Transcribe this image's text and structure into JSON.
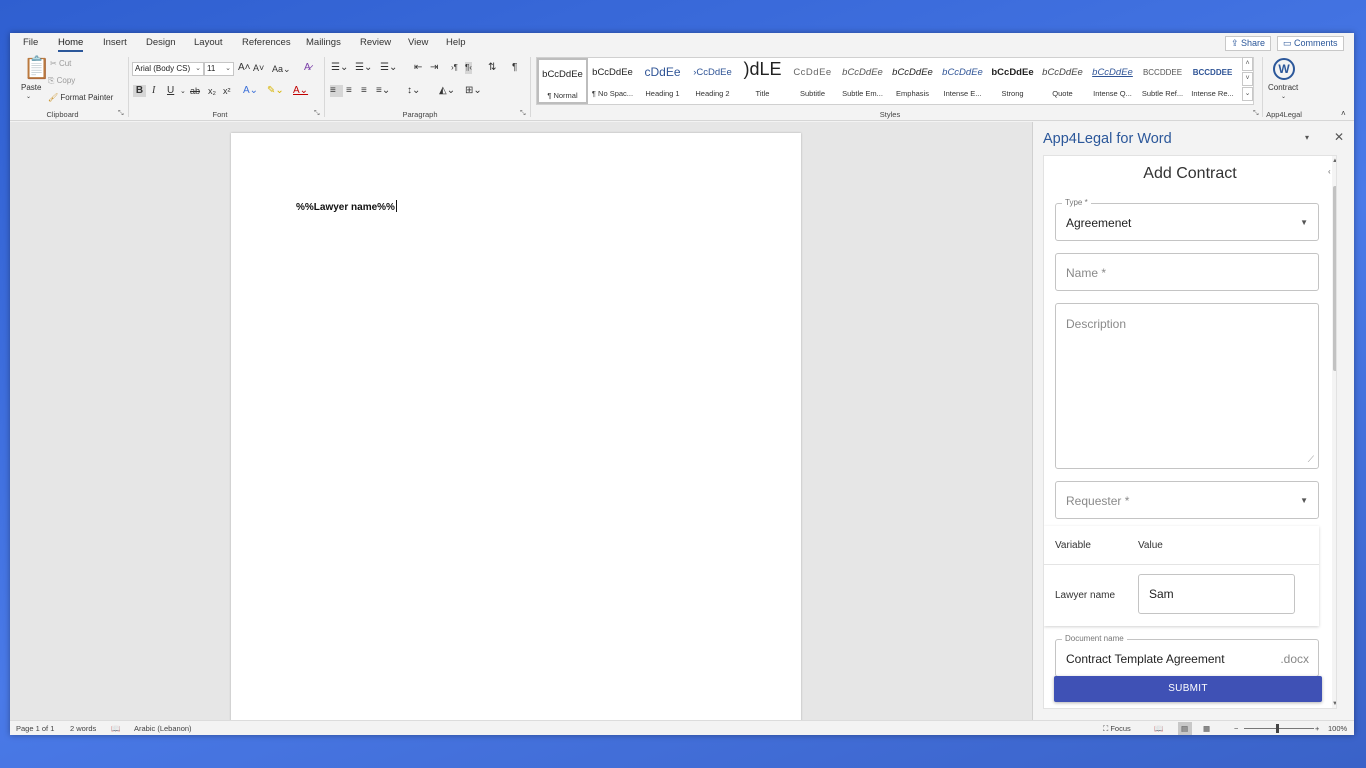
{
  "menu": {
    "tabs": [
      "File",
      "Home",
      "Insert",
      "Design",
      "Layout",
      "References",
      "Mailings",
      "Review",
      "View",
      "Help"
    ],
    "active_tab": "Home",
    "share": "Share",
    "comments": "Comments"
  },
  "ribbon": {
    "clipboard": {
      "paste": "Paste",
      "cut": "Cut",
      "copy": "Copy",
      "format_painter": "Format Painter",
      "label": "Clipboard"
    },
    "font": {
      "name": "Arial (Body CS)",
      "size": "11",
      "label": "Font",
      "grow": "A^",
      "shrink": "A^",
      "case": "Aa",
      "clear": "A",
      "bold": "B",
      "italic": "I",
      "underline": "U",
      "strike": "ab",
      "sub": "x₂",
      "sup": "x²"
    },
    "paragraph": {
      "label": "Paragraph"
    },
    "styles": {
      "label": "Styles",
      "items": [
        {
          "sample": "bCcDdEe",
          "name": "¶ Normal"
        },
        {
          "sample": "bCcDdEe",
          "name": "¶ No Spac..."
        },
        {
          "sample": "cDdEe",
          "name": "Heading 1"
        },
        {
          "sample": "›CcDdEe",
          "name": "Heading 2"
        },
        {
          "sample": ")dLE",
          "name": "Title"
        },
        {
          "sample": "CcDdEe",
          "name": "Subtitle"
        },
        {
          "sample": "bCcDdEe",
          "name": "Subtle Em..."
        },
        {
          "sample": "bCcDdEe",
          "name": "Emphasis"
        },
        {
          "sample": "bCcDdEe",
          "name": "Intense E..."
        },
        {
          "sample": "bCcDdEe",
          "name": "Strong"
        },
        {
          "sample": "bCcDdEe",
          "name": "Quote"
        },
        {
          "sample": "bCcDdEe",
          "name": "Intense Q..."
        },
        {
          "sample": "BCCDDEE",
          "name": "Subtle Ref..."
        },
        {
          "sample": "BCCDDEE",
          "name": "Intense Re..."
        }
      ]
    },
    "app4legal": {
      "button": "Contract",
      "label": "App4Legal"
    }
  },
  "document": {
    "text": "%%Lawyer name%%"
  },
  "pane": {
    "title": "App4Legal for Word",
    "form_title": "Add Contract",
    "type": {
      "label": "Type *",
      "value": "Agreemenet"
    },
    "name": {
      "placeholder": "Name *"
    },
    "description": {
      "placeholder": "Description"
    },
    "requester": {
      "placeholder": "Requester *"
    },
    "variables": {
      "col_variable": "Variable",
      "col_value": "Value",
      "rows": [
        {
          "variable": "Lawyer name",
          "value": "Sam"
        }
      ]
    },
    "document_name": {
      "label": "Document name",
      "value": "Contract Template Agreement",
      "ext": ".docx"
    },
    "submit": "SUBMIT"
  },
  "status": {
    "page": "Page 1 of 1",
    "words": "2 words",
    "language": "Arabic (Lebanon)",
    "focus": "Focus",
    "zoom": "100%"
  },
  "colors": {
    "accent": "#2b579a",
    "submit": "#3f51b5"
  }
}
